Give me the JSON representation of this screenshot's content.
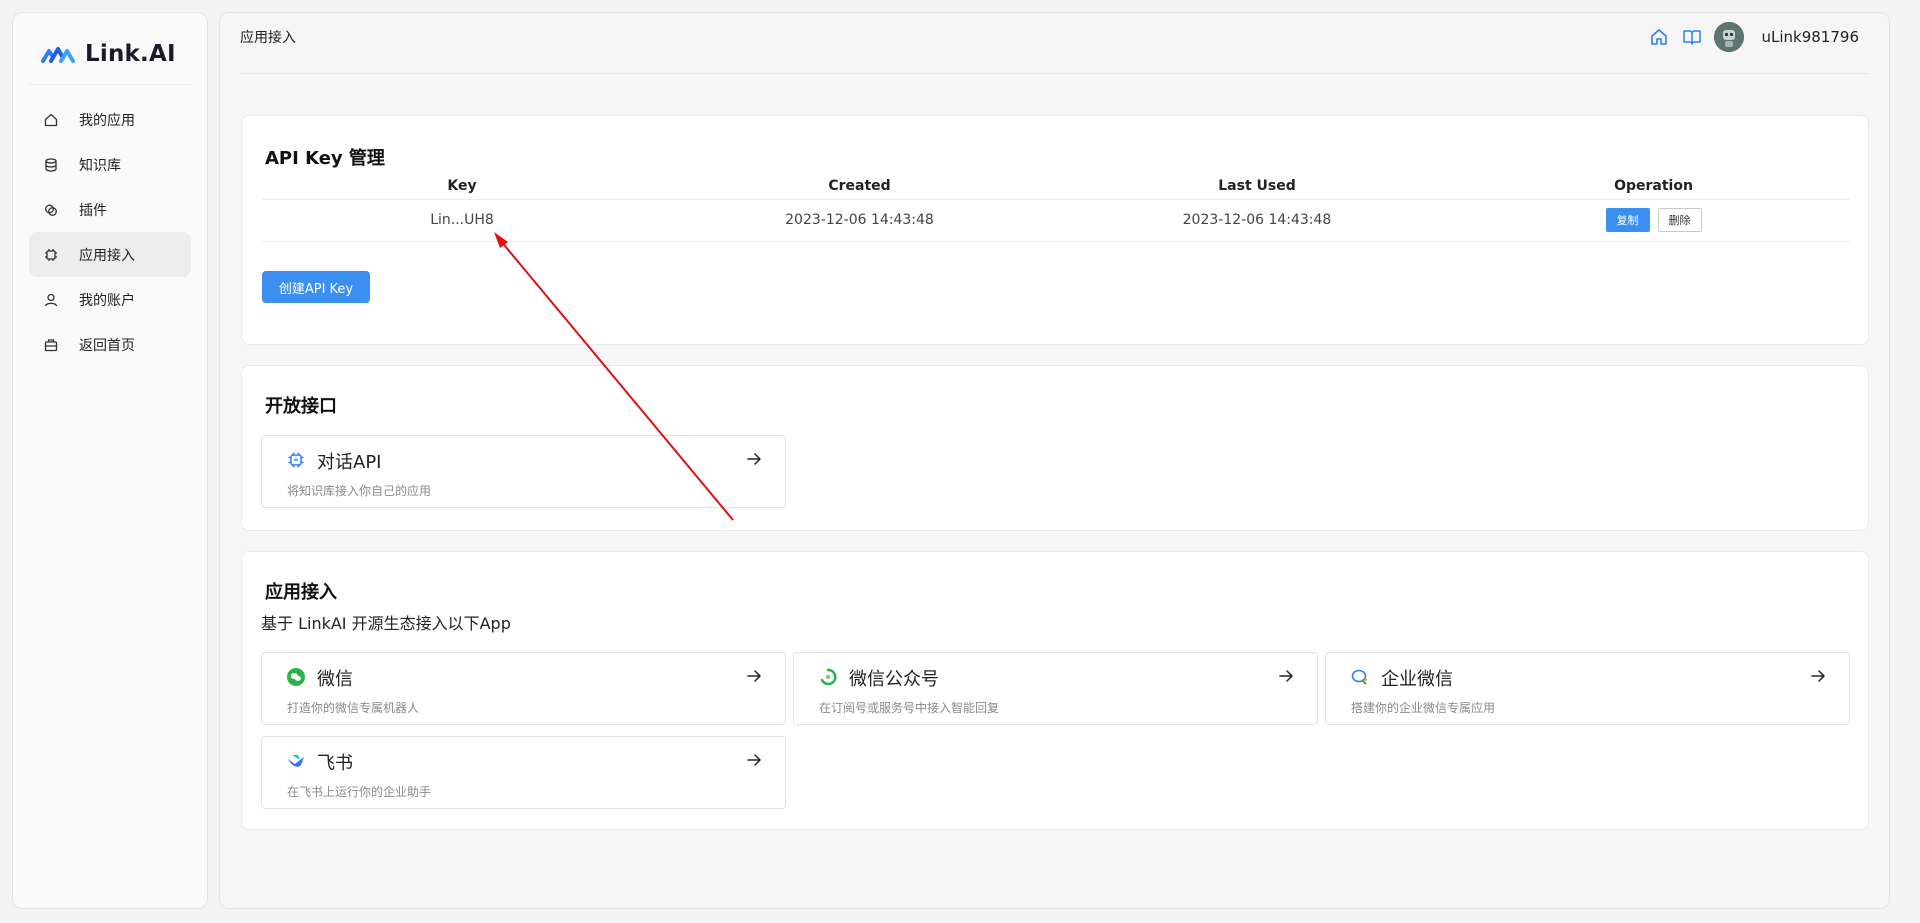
{
  "app": {
    "name": "Link.AI"
  },
  "sidebar": {
    "items": [
      {
        "label": "我的应用",
        "icon": "home-icon"
      },
      {
        "label": "知识库",
        "icon": "database-icon"
      },
      {
        "label": "插件",
        "icon": "plugin-icon"
      },
      {
        "label": "应用接入",
        "icon": "chip-icon",
        "active": true
      },
      {
        "label": "我的账户",
        "icon": "user-icon"
      },
      {
        "label": "返回首页",
        "icon": "briefcase-icon"
      }
    ]
  },
  "header": {
    "title": "应用接入",
    "username": "uLink981796",
    "icons": [
      "home-icon",
      "book-icon",
      "avatar"
    ]
  },
  "api_keys": {
    "title": "API Key 管理",
    "columns": [
      "Key",
      "Created",
      "Last Used",
      "Operation"
    ],
    "rows": [
      {
        "key": "Lin...UH8",
        "created": "2023-12-06 14:43:48",
        "last_used": "2023-12-06 14:43:48",
        "copy_label": "复制",
        "delete_label": "删除"
      }
    ],
    "create_label": "创建API Key"
  },
  "open_api": {
    "title": "开放接口",
    "tiles": [
      {
        "title": "对话API",
        "desc": "将知识库接入你自己的应用",
        "icon": "chip-icon"
      }
    ]
  },
  "integrations": {
    "title": "应用接入",
    "subtitle": "基于 LinkAI 开源生态接入以下App",
    "tiles": [
      {
        "title": "微信",
        "desc": "打造你的微信专属机器人",
        "icon": "wechat-icon"
      },
      {
        "title": "微信公众号",
        "desc": "在订阅号或服务号中接入智能回复",
        "icon": "wechat-official-icon"
      },
      {
        "title": "企业微信",
        "desc": "搭建你的企业微信专属应用",
        "icon": "wecom-icon"
      },
      {
        "title": "飞书",
        "desc": "在飞书上运行你的企业助手",
        "icon": "feishu-icon"
      }
    ]
  },
  "colors": {
    "accent": "#3b8ff0",
    "annotation": "#e01010",
    "wechat": "#2bb24c"
  }
}
